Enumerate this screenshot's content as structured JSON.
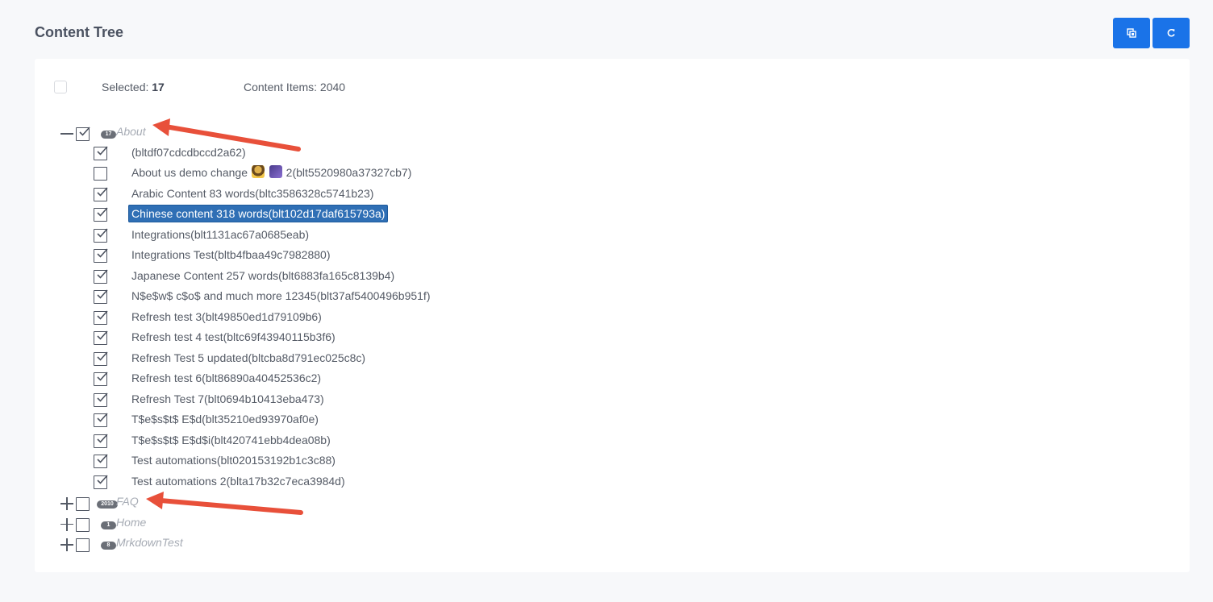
{
  "header": {
    "title": "Content Tree"
  },
  "toolbar": {
    "copy_icon": "copy-icon",
    "refresh_icon": "refresh-icon",
    "accent": "#1a73e8"
  },
  "summary": {
    "selected_label": "Selected:",
    "selected_count": "17",
    "items_label": "Content Items: 2040"
  },
  "tree": {
    "groups": [
      {
        "name": "About",
        "badge": "17",
        "expanded": true,
        "checked": true,
        "children": [
          {
            "label": "(bltdf07cdcdbccd2a62)",
            "checked": true,
            "selected": false
          },
          {
            "label_prefix": "About us demo change",
            "label_suffix": "2(blt5520980a37327cb7)",
            "emoji": [
              "person-emoji-icon",
              "music-emoji-icon"
            ],
            "checked": false,
            "selected": false
          },
          {
            "label": "Arabic Content 83 words(bltc3586328c5741b23)",
            "checked": true,
            "selected": false
          },
          {
            "label": "Chinese content 318 words(blt102d17daf615793a)",
            "checked": true,
            "selected": true
          },
          {
            "label": "Integrations(blt1131ac67a0685eab)",
            "checked": true,
            "selected": false
          },
          {
            "label": "Integrations Test(bltb4fbaa49c7982880)",
            "checked": true,
            "selected": false
          },
          {
            "label": "Japanese Content 257 words(blt6883fa165c8139b4)",
            "checked": true,
            "selected": false
          },
          {
            "label": "N$e$w$ c$o$ and much more 12345(blt37af5400496b951f)",
            "checked": true,
            "selected": false
          },
          {
            "label": "Refresh test 3(blt49850ed1d79109b6)",
            "checked": true,
            "selected": false
          },
          {
            "label": "Refresh test 4 test(bltc69f43940115b3f6)",
            "checked": true,
            "selected": false
          },
          {
            "label": "Refresh Test 5 updated(bltcba8d791ec025c8c)",
            "checked": true,
            "selected": false
          },
          {
            "label": "Refresh test 6(blt86890a40452536c2)",
            "checked": true,
            "selected": false
          },
          {
            "label": "Refresh Test 7(blt0694b10413eba473)",
            "checked": true,
            "selected": false
          },
          {
            "label": "T$e$s$t$ E$d(blt35210ed93970af0e)",
            "checked": true,
            "selected": false
          },
          {
            "label": "T$e$s$t$ E$d$i(blt420741ebb4dea08b)",
            "checked": true,
            "selected": false
          },
          {
            "label": "Test automations(blt020153192b1c3c88)",
            "checked": true,
            "selected": false
          },
          {
            "label": "Test automations 2(blta17b32c7eca3984d)",
            "checked": true,
            "selected": false
          }
        ]
      },
      {
        "name": "FAQ",
        "badge": "2010",
        "expanded": false,
        "checked": false
      },
      {
        "name": "Home",
        "badge": "1",
        "expanded": false,
        "checked": false
      },
      {
        "name": "MrkdownTest",
        "badge": "8",
        "expanded": false,
        "checked": false
      }
    ]
  },
  "annotations": {
    "arrow_color": "#e8503a"
  }
}
